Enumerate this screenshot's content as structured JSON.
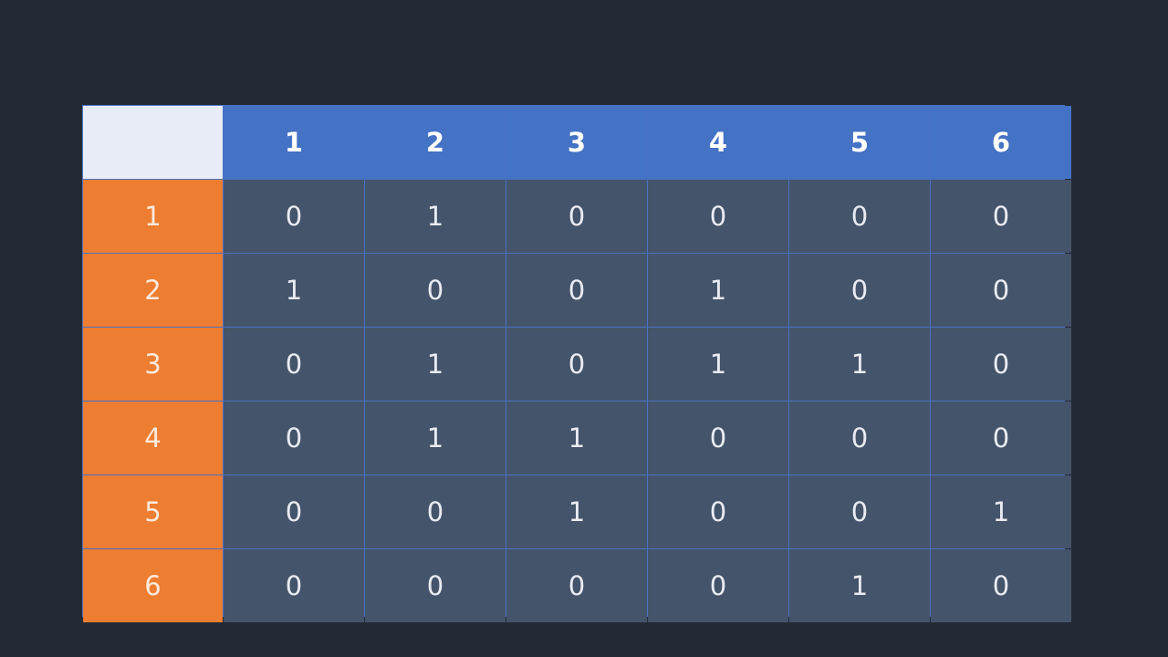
{
  "matrix": {
    "corner": "",
    "column_headers": [
      "1",
      "2",
      "3",
      "4",
      "5",
      "6"
    ],
    "rows": [
      {
        "label": "1",
        "values": [
          "0",
          "1",
          "0",
          "0",
          "0",
          "0"
        ]
      },
      {
        "label": "2",
        "values": [
          "1",
          "0",
          "0",
          "1",
          "0",
          "0"
        ]
      },
      {
        "label": "3",
        "values": [
          "0",
          "1",
          "0",
          "1",
          "1",
          "0"
        ]
      },
      {
        "label": "4",
        "values": [
          "0",
          "1",
          "1",
          "0",
          "0",
          "0"
        ]
      },
      {
        "label": "5",
        "values": [
          "0",
          "0",
          "1",
          "0",
          "0",
          "1"
        ]
      },
      {
        "label": "6",
        "values": [
          "0",
          "0",
          "0",
          "0",
          "1",
          "0"
        ]
      }
    ]
  },
  "colors": {
    "background": "#232935",
    "column_header": "#4472c4",
    "row_header": "#ed7d31",
    "cell": "#44546a",
    "corner": "#e8ecf6"
  }
}
